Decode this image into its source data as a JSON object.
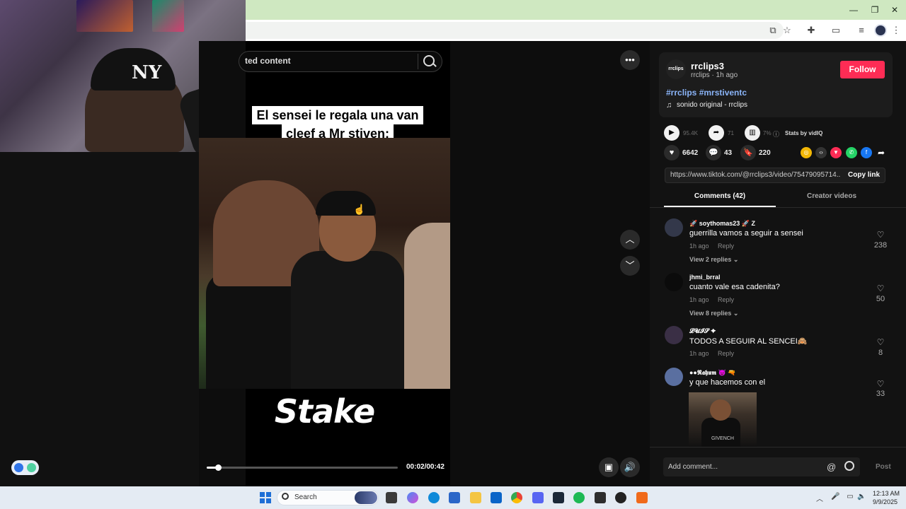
{
  "window_controls": {
    "minimize": "—",
    "restore": "❐",
    "close": "✕"
  },
  "search": {
    "text": "ted content"
  },
  "video": {
    "caption_lines": [
      "El sensei le regala una van",
      "cleef a Mr stiven:"
    ],
    "brand_watermark": "Stake",
    "time": "00:02/00:42",
    "progress_fraction": 0.06
  },
  "author": {
    "avatar_label": "rrclips",
    "handle": "rrclips3",
    "meta": "rrclips · 1h ago",
    "follow_label": "Follow",
    "hashtags": "#rrclips #mrstiventc",
    "music": "sonido original - rrclips"
  },
  "stats": {
    "plays": "95.4K",
    "shares": "71",
    "engagement": "7%",
    "stats_by": "Stats by vidIQ"
  },
  "actions": {
    "likes": "6642",
    "comments": "43",
    "saves": "220"
  },
  "link": {
    "url": "https://www.tiktok.com/@rrclips3/video/75479095714...",
    "copy_label": "Copy link"
  },
  "tabs": {
    "comments": "Comments (42)",
    "creator": "Creator videos"
  },
  "comments": [
    {
      "user": "🚀 soythomas23 🚀 Z",
      "text": "guerrilla vamos a seguir a sensei",
      "time": "1h ago",
      "reply": "Reply",
      "view_replies": "View 2 replies ⌄",
      "likes": "238"
    },
    {
      "user": "jhmi_brral",
      "text": "cuanto vale esa cadenita?",
      "time": "1h ago",
      "reply": "Reply",
      "view_replies": "View 8 replies ⌄",
      "likes": "50"
    },
    {
      "user": "𝓛𝓤𝓘𝓢 ✦",
      "text": "TODOS A SEGUIR AL SENCEI🙈",
      "time": "1h ago",
      "reply": "Reply",
      "likes": "8"
    },
    {
      "user": "●●𝕽𝖆𝖍𝖚𝖒 👿 🔫",
      "text": "y que hacemos con el",
      "likes": "33",
      "image_text": "GIVENCH"
    }
  ],
  "add_comment": {
    "placeholder": "Add comment...",
    "post": "Post"
  },
  "taskbar": {
    "search_text": "Search",
    "time": "12:13 AM",
    "date": "9/9/2025"
  },
  "colors": {
    "follow": "#fe2c55",
    "hashtag": "#8ab4f8",
    "titlebar": "#cfe8c1",
    "taskbar": "#e4ebf3"
  }
}
